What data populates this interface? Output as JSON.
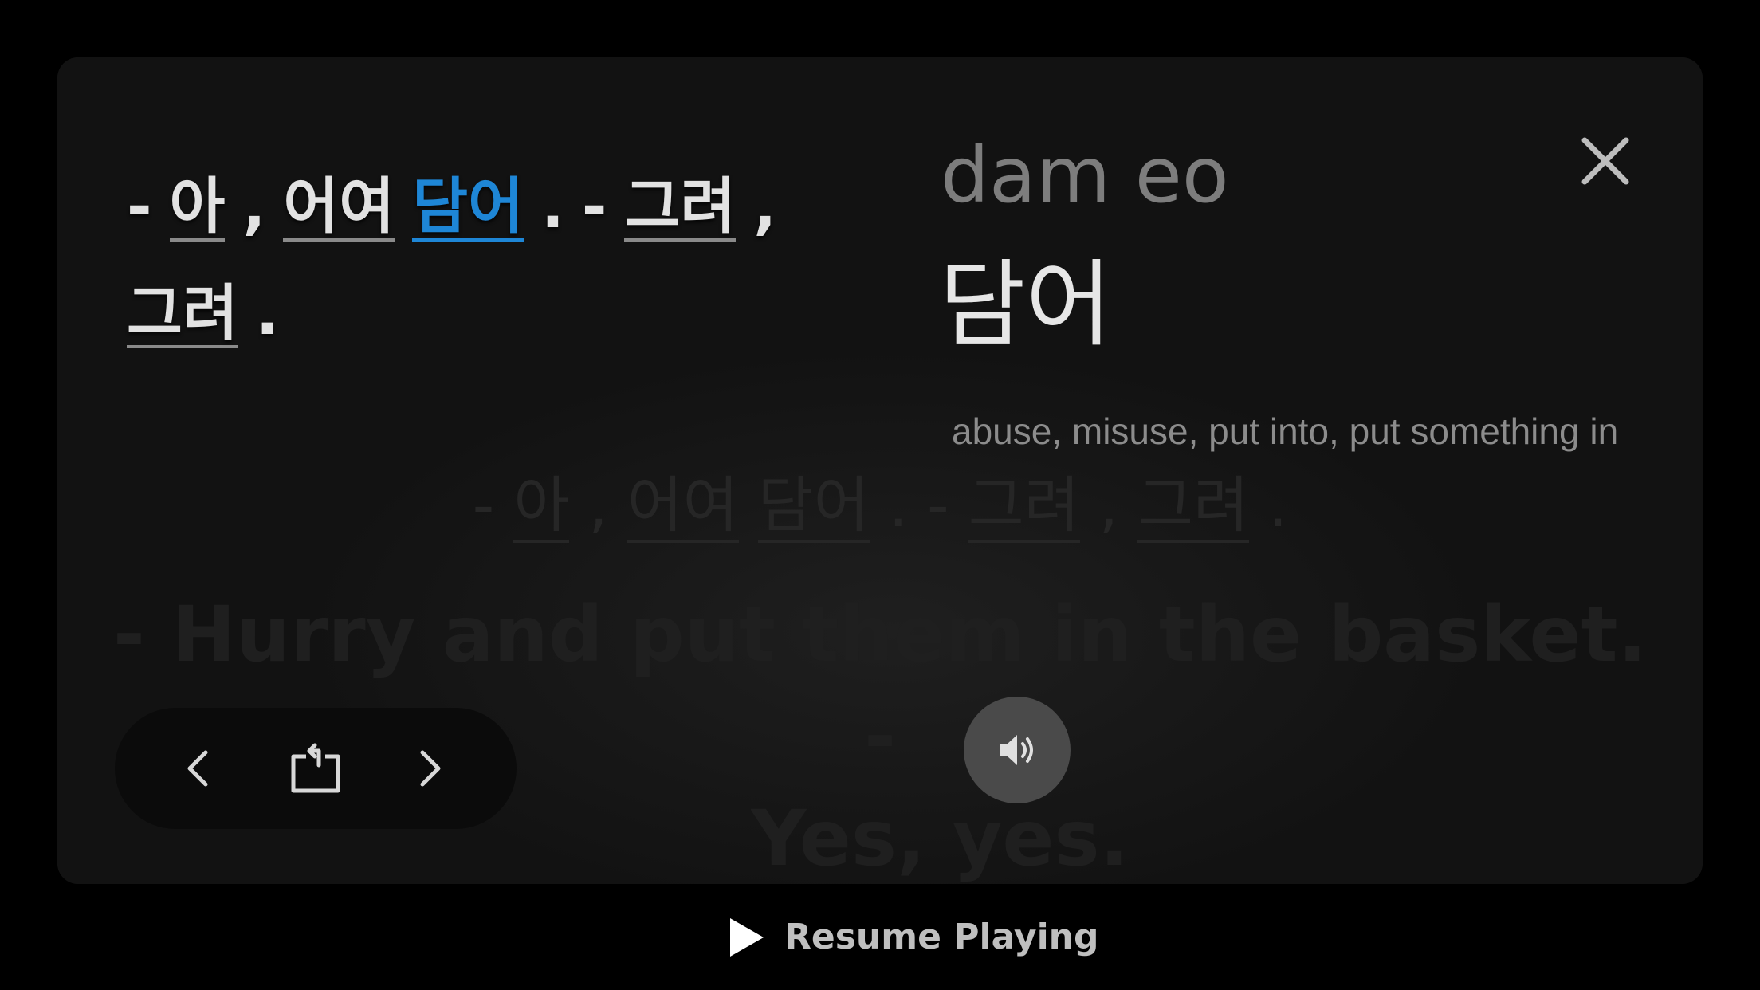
{
  "background_subtitle": {
    "korean": [
      "-",
      "아",
      ",",
      "어여",
      "담어",
      ".",
      "-",
      "그려",
      ",",
      "그려",
      "."
    ],
    "english_line1": "- Hurry and put them in the basket. -",
    "english_line2": "Yes, yes."
  },
  "subtitle": {
    "tokens": [
      {
        "text": "-",
        "word": false
      },
      {
        "text": "아",
        "word": true
      },
      {
        "text": ",",
        "word": false
      },
      {
        "text": "어여",
        "word": true
      },
      {
        "text": "담어",
        "word": true,
        "active": true
      },
      {
        "text": ".",
        "word": false
      },
      {
        "text": "-",
        "word": false
      },
      {
        "text": "그려",
        "word": true
      },
      {
        "text": ",",
        "word": false
      },
      {
        "text": "그려",
        "word": true
      },
      {
        "text": ".",
        "word": false
      }
    ]
  },
  "lookup": {
    "romanization": "dam eo",
    "headword": "담어",
    "definition": "abuse, misuse, put into, put something in"
  },
  "controls": {
    "prev_icon": "chevron-left-icon",
    "repeat_icon": "repeat-subtitle-icon",
    "next_icon": "chevron-right-icon",
    "audio_icon": "speaker-icon",
    "close_icon": "close-icon"
  },
  "resume": {
    "label": "Resume Playing",
    "icon": "play-icon"
  },
  "colors": {
    "accent": "#1e86d6",
    "panel": "#121212",
    "background": "#000000"
  }
}
